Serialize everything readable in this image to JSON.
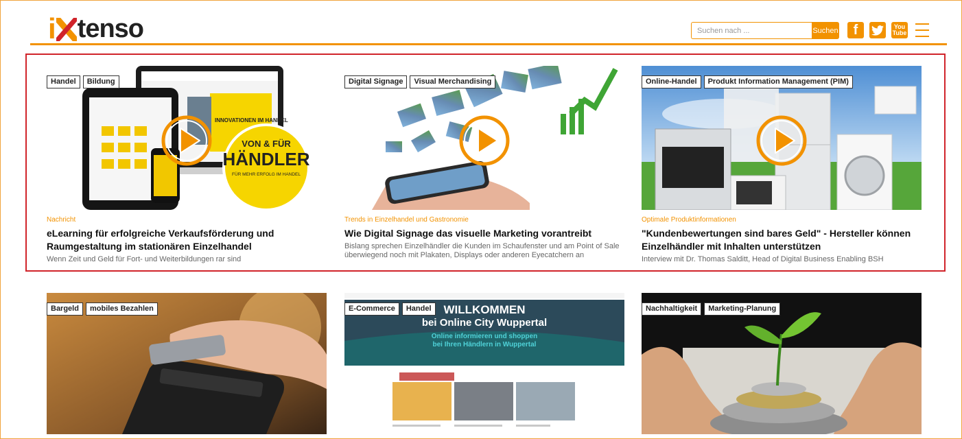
{
  "header": {
    "logo": {
      "part_i": "i",
      "part_rest": "tenso"
    },
    "search": {
      "placeholder": "Suchen nach ...",
      "button_label": "Suchen"
    },
    "social": {
      "facebook": "f",
      "youtube_top": "You",
      "youtube_bottom": "Tube"
    }
  },
  "colors": {
    "brand": "#f29200",
    "highlight_frame": "#d0232a"
  },
  "featured": [
    {
      "tags": [
        "Handel",
        "Bildung"
      ],
      "has_video": true,
      "image_labels": {
        "badge_line1": "VON & FÜR",
        "badge_line2": "HÄNDLER",
        "badge_line3": "FÜR MEHR ERFOLG IM HANDEL",
        "screen_text": "INNOVATIONEN IM HANDEL"
      },
      "category": "Nachricht",
      "title": "eLearning für erfolgreiche Verkaufsförderung und Raumgestaltung im stationären Einzelhandel",
      "teaser": "Wenn Zeit und Geld für Fort- und Weiterbildungen rar sind"
    },
    {
      "tags": [
        "Digital Signage",
        "Visual Merchandising"
      ],
      "has_video": true,
      "category": "Trends in Einzelhandel und Gastronomie",
      "title": "Wie Digital Signage das visuelle Marketing vorantreibt",
      "teaser": "Bislang sprechen Einzelhändler die Kunden im Schaufenster und am Point of Sale überwiegend noch mit Plakaten, Displays oder anderen Eyecatchern an"
    },
    {
      "tags": [
        "Online-Handel",
        "Produkt Information Management (PIM)"
      ],
      "has_video": true,
      "category": "Optimale Produktinformationen",
      "title": "\"Kundenbewertungen sind bares Geld\" - Hersteller können Einzelhändler mit Inhalten unterstützen",
      "teaser": "Interview mit Dr. Thomas Salditt, Head of Digital Business Enabling BSH"
    }
  ],
  "more": [
    {
      "tags": [
        "Bargeld",
        "mobiles Bezahlen"
      ]
    },
    {
      "tags": [
        "E-Commerce",
        "Handel"
      ],
      "image_labels": {
        "headline1": "WILLKOMMEN",
        "headline2": "bei Online City Wuppertal",
        "sub1": "Online informieren und shoppen",
        "sub2": "bei Ihren Händlern in Wuppertal"
      }
    },
    {
      "tags": [
        "Nachhaltigkeit",
        "Marketing-Planung"
      ]
    }
  ]
}
